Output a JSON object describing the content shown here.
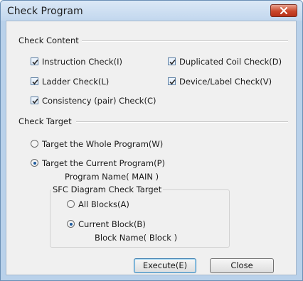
{
  "window": {
    "title": "Check Program"
  },
  "check_content": {
    "heading": "Check Content",
    "items": [
      {
        "label": "Instruction Check(I)",
        "checked": true
      },
      {
        "label": "Duplicated Coil Check(D)",
        "checked": true
      },
      {
        "label": "Ladder Check(L)",
        "checked": true
      },
      {
        "label": "Device/Label Check(V)",
        "checked": true
      },
      {
        "label": "Consistency (pair) Check(C)",
        "checked": true
      }
    ]
  },
  "check_target": {
    "heading": "Check Target",
    "options": [
      {
        "label": "Target the Whole Program(W)",
        "selected": false
      },
      {
        "label": "Target the Current Program(P)",
        "selected": true
      }
    ],
    "program_name": "Program Name( MAIN )",
    "sfc": {
      "title": "SFC Diagram Check Target",
      "options": [
        {
          "label": "All Blocks(A)",
          "selected": false
        },
        {
          "label": "Current Block(B)",
          "selected": true
        }
      ],
      "block_name": "Block Name( Block )"
    }
  },
  "buttons": {
    "execute": "Execute(E)",
    "close": "Close"
  },
  "icons": {
    "close": "close-x-icon",
    "checkbox_mark": "checkmark-icon"
  },
  "colors": {
    "title_bar": "#c2d7ee",
    "close_button": "#c9472b",
    "dialog_bg": "#f0f0f0",
    "radio_dot": "#1d5a9e"
  }
}
